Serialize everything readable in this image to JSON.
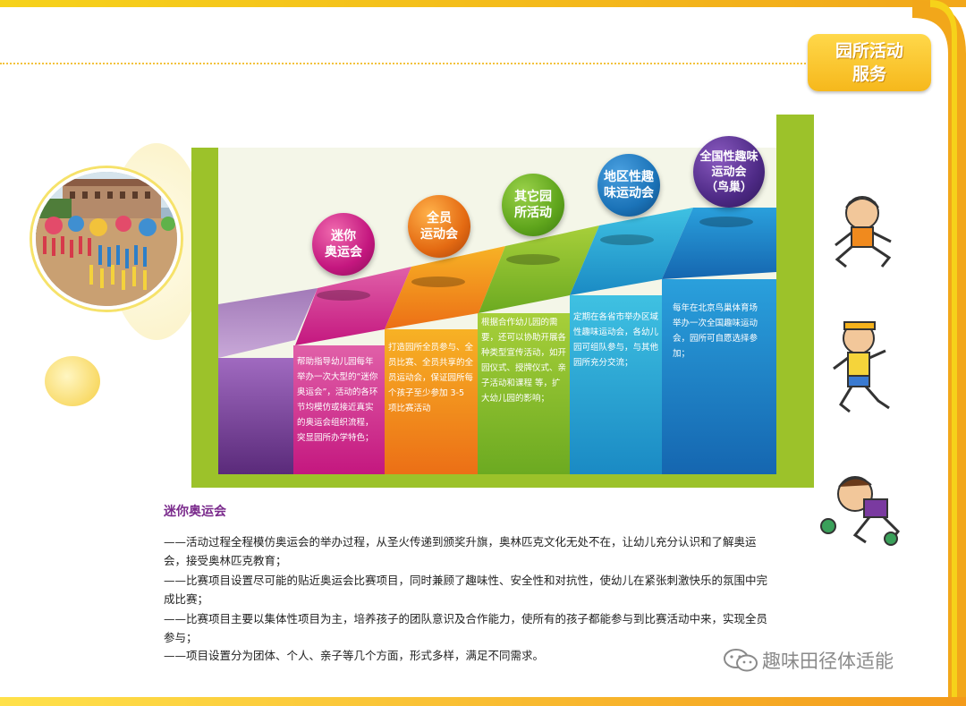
{
  "badge": {
    "line1": "园所活动",
    "line2": "服务"
  },
  "steps": [
    {
      "circle": "迷你\n奥运会",
      "text": "帮助指导幼儿园每年举办一次大型的“迷你奥运会”，活动的各环节均模仿或接近真实的奥运会组织流程，突显园所办学特色；",
      "circle_color": "#c4177f",
      "step_color": "#e0348f"
    },
    {
      "circle": "全员\n运动会",
      "text": "打造园所全员参与、全员比赛、全员共享的全员运动会，保证园所每个孩子至少参加 3-5 项比赛活动",
      "circle_color": "#e46a12",
      "step_color": "#f29a1d"
    },
    {
      "circle": "其它园\n所活动",
      "text": "根据合作幼儿园的需要，还可以协助开展各种类型宣传活动，如开园仪式、授牌仪式、亲子活动和课程 等，扩大幼儿园的影响；",
      "circle_color": "#5fa51c",
      "step_color": "#8fc02a"
    },
    {
      "circle": "地区性趣\n味运动会",
      "text": "定期在各省市举办区域性趣味运动会，各幼儿园可组队参与，与其他园所充分交流；",
      "circle_color": "#1b73b8",
      "step_color": "#2aaad8"
    },
    {
      "circle": "全国性趣味\n运动会\n（鸟巢）",
      "text": "每年在北京鸟巢体育场举办一次全国趣味运动会，园所可自愿选择参加；",
      "circle_color": "#4e2a86",
      "step_color": "#1a86c8"
    }
  ],
  "section": {
    "title": "迷你奥运会",
    "paragraphs": [
      "——活动过程全程模仿奥运会的举办过程，从圣火传递到颁奖升旗，奥林匹克文化无处不在，让幼儿充分认识和了解奥运会，接受奥林匹克教育；",
      "——比赛项目设置尽可能的贴近奥运会比赛项目，同时兼顾了趣味性、安全性和对抗性，使幼儿在紧张刺激快乐的氛围中完成比赛；",
      "——比赛项目主要以集体性项目为主，培养孩子的团队意识及合作能力，使所有的孩子都能参与到比赛活动中来，实现全员参与；",
      "——项目设置分为团体、个人、亲子等几个方面，形式多样，满足不同需求。"
    ]
  },
  "brand": {
    "text": "趣味田径体适能",
    "icon": "wechat-icon"
  }
}
